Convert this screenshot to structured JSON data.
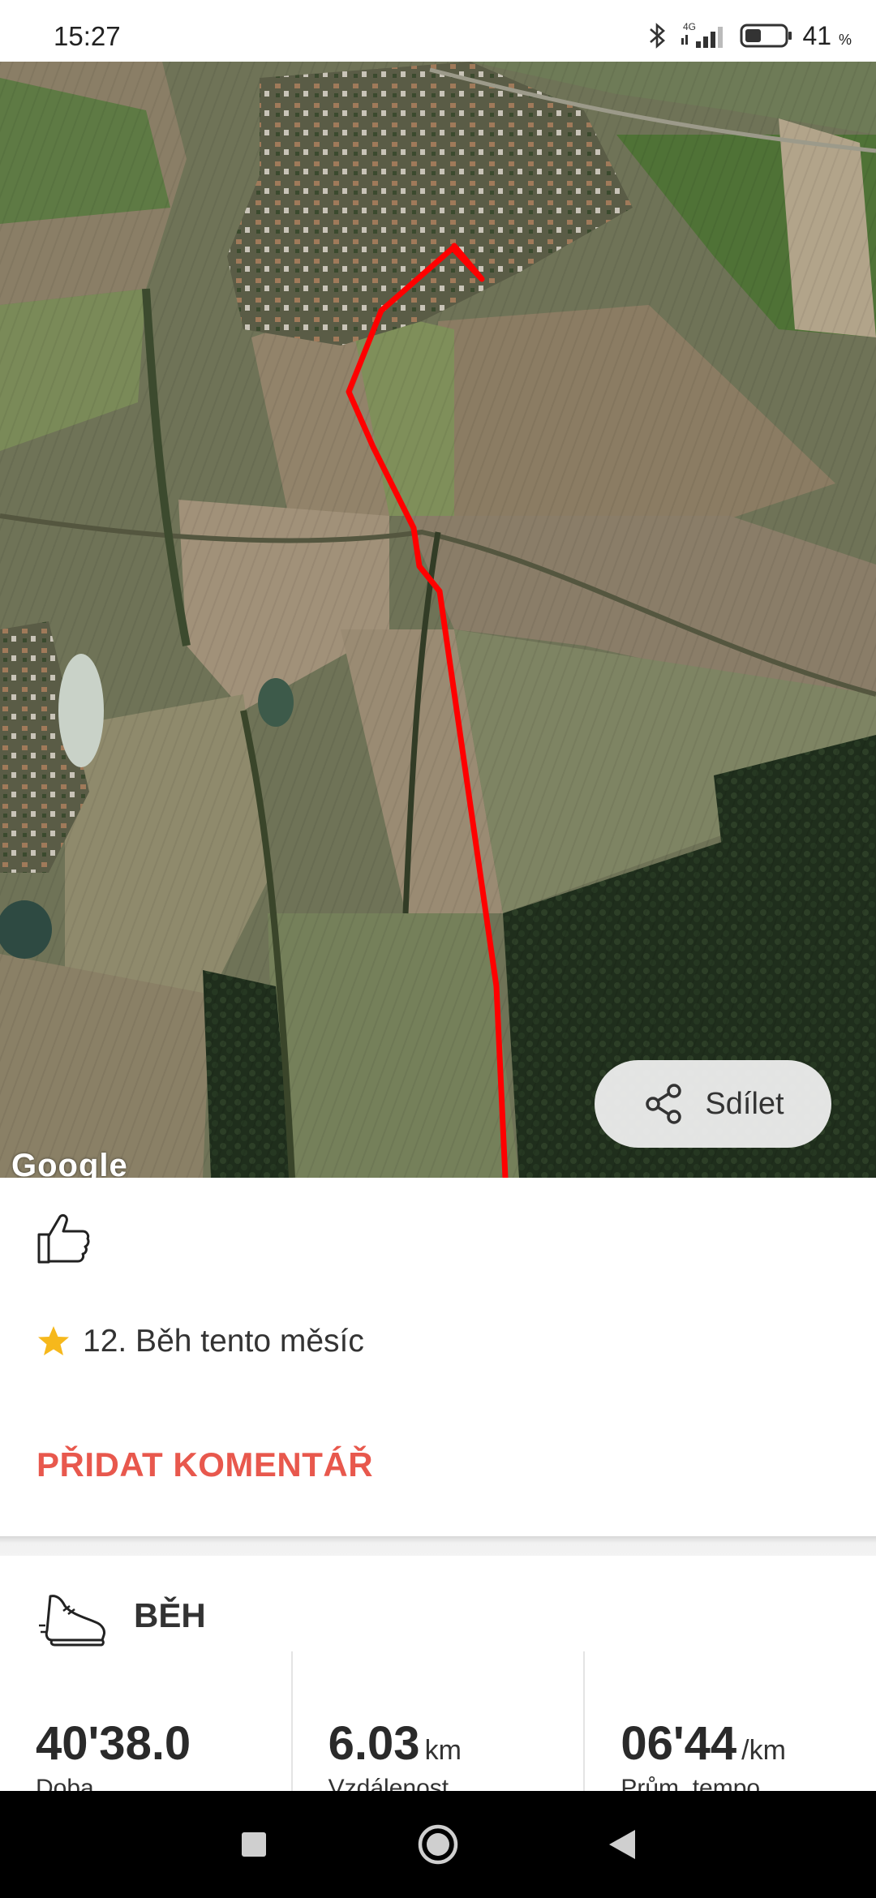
{
  "status_bar": {
    "time": "15:27",
    "network": "4G",
    "battery_percent": "41",
    "battery_unit": "%",
    "battery_level": 0.41,
    "icons": [
      "bluetooth-icon",
      "signal-icon",
      "battery-icon"
    ]
  },
  "map": {
    "attribution": "Google",
    "route_color": "#ff0000",
    "share_label": "Sdílet"
  },
  "activity": {
    "achievement": "12. Běh tento měsíc",
    "add_comment": "PŘIDAT KOMENTÁŘ",
    "type": "BĚH",
    "accent_color": "#e8584d",
    "stats": [
      {
        "value": "40'38.0",
        "unit": "",
        "label": "Doba"
      },
      {
        "value": "6.03",
        "unit": "km",
        "label": "Vzdálenost"
      },
      {
        "value": "06'44",
        "unit": "/km",
        "label": "Prům. tempo"
      }
    ]
  },
  "nav": {
    "items": [
      "recents-icon",
      "home-icon",
      "back-icon"
    ]
  }
}
